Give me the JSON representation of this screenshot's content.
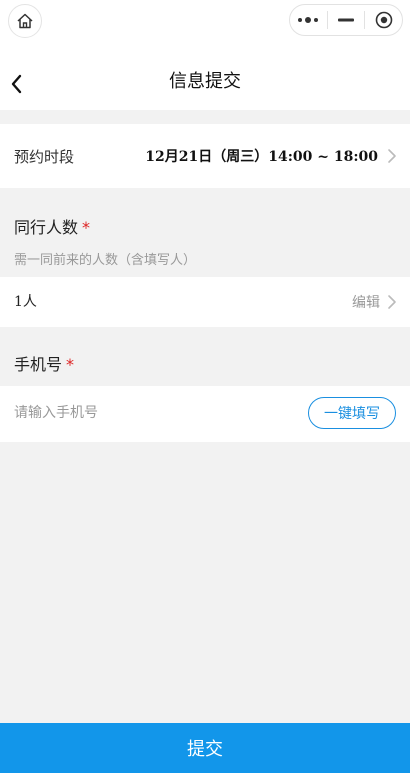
{
  "nav": {
    "title": "信息提交"
  },
  "appointment": {
    "label": "预约时段",
    "value": "12月21日（周三）14:00 ~ 18:00"
  },
  "companions": {
    "label": "同行人数",
    "required_mark": "*",
    "hint": "需一同前来的人数（含填写人）",
    "value": "1人",
    "edit_label": "编辑"
  },
  "phone": {
    "label": "手机号",
    "required_mark": "*",
    "placeholder": "请输入手机号",
    "autofill_label": "一键填写"
  },
  "submit": {
    "label": "提交"
  },
  "colors": {
    "accent": "#1296ea",
    "required": "#d22222",
    "hint": "#999999"
  },
  "icons": {
    "home": "home-icon",
    "more": "more-dots-icon",
    "minimize": "minimize-icon",
    "close": "close-target-icon",
    "back": "chevron-left-icon",
    "row_arrow": "chevron-right-icon"
  }
}
